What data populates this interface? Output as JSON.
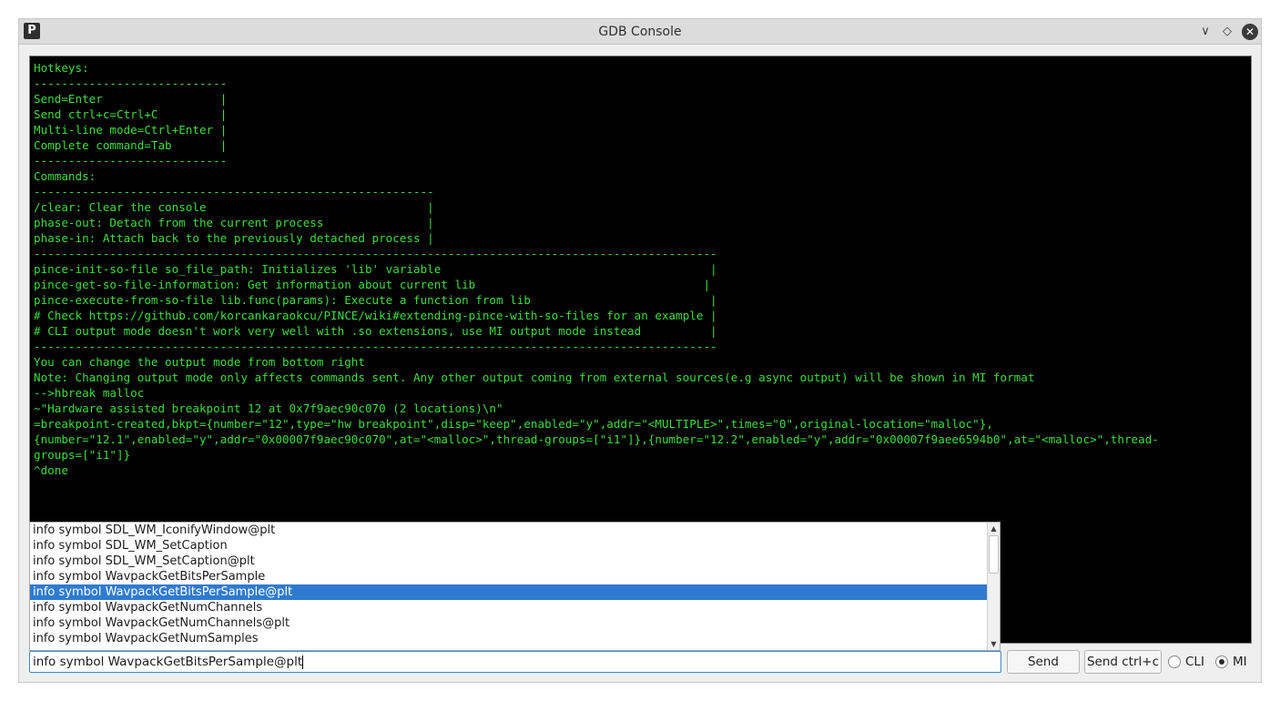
{
  "window": {
    "title": "GDB Console",
    "logo_letter": "P",
    "minimize_glyph": "∨",
    "maximize_glyph": "◇",
    "close_glyph": "✕"
  },
  "console": {
    "lines": [
      "Hotkeys:",
      "----------------------------",
      "Send=Enter                 |",
      "Send ctrl+c=Ctrl+C         |",
      "Multi-line mode=Ctrl+Enter |",
      "Complete command=Tab       |",
      "----------------------------",
      "Commands:",
      "----------------------------------------------------------",
      "/clear: Clear the console                                |",
      "phase-out: Detach from the current process               |",
      "phase-in: Attach back to the previously detached process |",
      "---------------------------------------------------------------------------------------------------",
      "pince-init-so-file so_file_path: Initializes 'lib' variable                                       |",
      "pince-get-so-file-information: Get information about current lib                                 |",
      "pince-execute-from-so-file lib.func(params): Execute a function from lib                          |",
      "# Check https://github.com/korcankaraokcu/PINCE/wiki#extending-pince-with-so-files for an example |",
      "# CLI output mode doesn't work very well with .so extensions, use MI output mode instead          |",
      "---------------------------------------------------------------------------------------------------",
      "You can change the output mode from bottom right",
      "Note: Changing output mode only affects commands sent. Any other output coming from external sources(e.g async output) will be shown in MI format",
      "-->hbreak malloc",
      "~\"Hardware assisted breakpoint 12 at 0x7f9aec90c070 (2 locations)\\n\"",
      "=breakpoint-created,bkpt={number=\"12\",type=\"hw breakpoint\",disp=\"keep\",enabled=\"y\",addr=\"<MULTIPLE>\",times=\"0\",original-location=\"malloc\"},",
      "{number=\"12.1\",enabled=\"y\",addr=\"0x00007f9aec90c070\",at=\"<malloc>\",thread-groups=[\"i1\"]},{number=\"12.2\",enabled=\"y\",addr=\"0x00007f9aee6594b0\",at=\"<malloc>\",thread-",
      "groups=[\"i1\"]}",
      "^done"
    ]
  },
  "completion": {
    "items": [
      "info symbol SDL_WM_IconifyWindow@plt",
      "info symbol SDL_WM_SetCaption",
      "info symbol SDL_WM_SetCaption@plt",
      "info symbol WavpackGetBitsPerSample",
      "info symbol WavpackGetBitsPerSample@plt",
      "info symbol WavpackGetNumChannels",
      "info symbol WavpackGetNumChannels@plt",
      "info symbol WavpackGetNumSamples"
    ],
    "selected_index": 4,
    "scroll_up_glyph": "▲",
    "scroll_down_glyph": "▼"
  },
  "input": {
    "value": "info symbol WavpackGetBitsPerSample@plt"
  },
  "buttons": {
    "send": "Send",
    "send_ctrl_c": "Send ctrl+c"
  },
  "output_mode": {
    "options": [
      "CLI",
      "MI"
    ],
    "selected": "MI"
  }
}
